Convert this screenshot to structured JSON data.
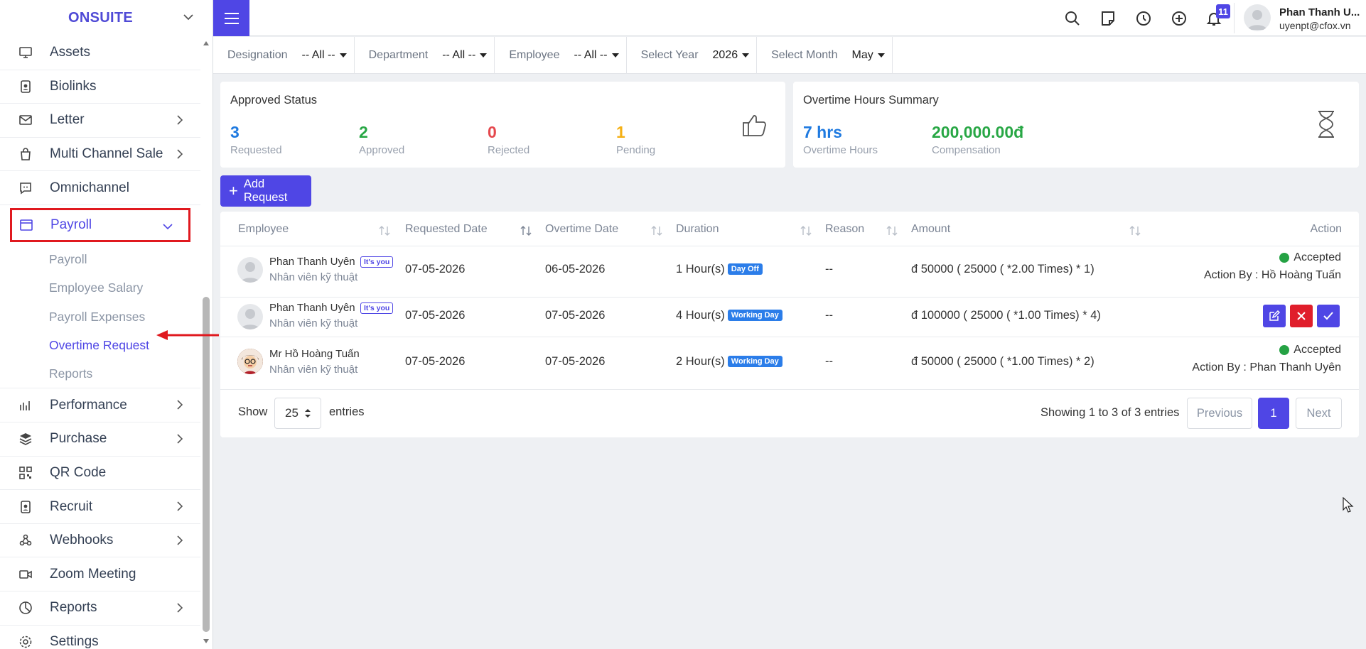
{
  "app": {
    "brand": "ONSUITE"
  },
  "sidebar": {
    "items_top": [
      {
        "label": "Assets",
        "icon": "monitor-icon",
        "has_arrow": false
      },
      {
        "label": "Biolinks",
        "icon": "id-badge-icon",
        "has_arrow": false
      },
      {
        "label": "Letter",
        "icon": "mail-icon",
        "has_arrow": true
      },
      {
        "label": "Multi Channel Sale",
        "icon": "shopping-bag-icon",
        "has_arrow": true
      },
      {
        "label": "Omnichannel",
        "icon": "chat-icon",
        "has_arrow": false
      }
    ],
    "active": {
      "label": "Payroll",
      "icon": "window-icon"
    },
    "subitems": [
      {
        "label": "Payroll"
      },
      {
        "label": "Employee Salary"
      },
      {
        "label": "Payroll Expenses"
      },
      {
        "label": "Overtime Request",
        "current": true
      },
      {
        "label": "Reports"
      }
    ],
    "items_bottom": [
      {
        "label": "Performance",
        "icon": "bar-chart-icon",
        "has_arrow": true
      },
      {
        "label": "Purchase",
        "icon": "layers-icon",
        "has_arrow": true
      },
      {
        "label": "QR Code",
        "icon": "qr-code-icon",
        "has_arrow": false
      },
      {
        "label": "Recruit",
        "icon": "id-badge-icon",
        "has_arrow": true
      },
      {
        "label": "Webhooks",
        "icon": "webhook-icon",
        "has_arrow": true
      },
      {
        "label": "Zoom Meeting",
        "icon": "video-icon",
        "has_arrow": false
      },
      {
        "label": "Reports",
        "icon": "pie-chart-icon",
        "has_arrow": true
      },
      {
        "label": "Settings",
        "icon": "gear-icon",
        "has_arrow": false
      }
    ]
  },
  "topbar": {
    "notification_count": "11",
    "user_name": "Phan Thanh U...",
    "user_email": "uyenpt@cfox.vn"
  },
  "filters": [
    {
      "label": "Designation",
      "value": "-- All --"
    },
    {
      "label": "Department",
      "value": "-- All --"
    },
    {
      "label": "Employee",
      "value": "-- All --"
    },
    {
      "label": "Select Year",
      "value": "2026"
    },
    {
      "label": "Select Month",
      "value": "May"
    }
  ],
  "approved_status": {
    "title": "Approved Status",
    "stats": [
      {
        "value": "3",
        "label": "Requested",
        "color": "#1f7ae0"
      },
      {
        "value": "2",
        "label": "Approved",
        "color": "#28a745"
      },
      {
        "value": "0",
        "label": "Rejected",
        "color": "#e5484d"
      },
      {
        "value": "1",
        "label": "Pending",
        "color": "#f5b014"
      }
    ]
  },
  "overtime_summary": {
    "title": "Overtime Hours Summary",
    "hours_value": "7 hrs",
    "hours_label": "Overtime Hours",
    "compensation_value": "200,000.00đ",
    "compensation_label": "Compensation"
  },
  "add_request_label": "Add Request",
  "table": {
    "columns": [
      "Employee",
      "Requested Date",
      "Overtime Date",
      "Duration",
      "Reason",
      "Amount",
      "Action"
    ],
    "rows": [
      {
        "name": "Phan Thanh Uyên",
        "you_tag": "It's you",
        "role": "Nhân viên kỹ thuật",
        "requested": "07-05-2026",
        "overtime": "06-05-2026",
        "duration": "1 Hour(s)",
        "day_type": "Day Off",
        "reason": "--",
        "amount": "đ 50000 ( 25000 ( *2.00 Times) * 1)",
        "status": "Accepted",
        "action_by": "Action By : Hồ Hoàng Tuấn"
      },
      {
        "name": "Phan Thanh Uyên",
        "you_tag": "It's you",
        "role": "Nhân viên kỹ thuật",
        "requested": "07-05-2026",
        "overtime": "07-05-2026",
        "duration": "4 Hour(s)",
        "day_type": "Working Day",
        "reason": "--",
        "amount": "đ 100000 ( 25000 ( *1.00 Times) * 4)"
      },
      {
        "name": "Mr Hồ Hoàng Tuấn",
        "role": "Nhân viên kỹ thuật",
        "requested": "07-05-2026",
        "overtime": "07-05-2026",
        "duration": "2 Hour(s)",
        "day_type": "Working Day",
        "reason": "--",
        "amount": "đ 50000 ( 25000 ( *1.00 Times) * 2)",
        "status": "Accepted",
        "action_by": "Action By : Phan Thanh Uyên"
      }
    ],
    "show_label": "Show",
    "entries_value": "25",
    "entries_label": "entries",
    "info": "Showing 1 to 3 of 3 entries",
    "prev": "Previous",
    "page": "1",
    "next": "Next"
  }
}
